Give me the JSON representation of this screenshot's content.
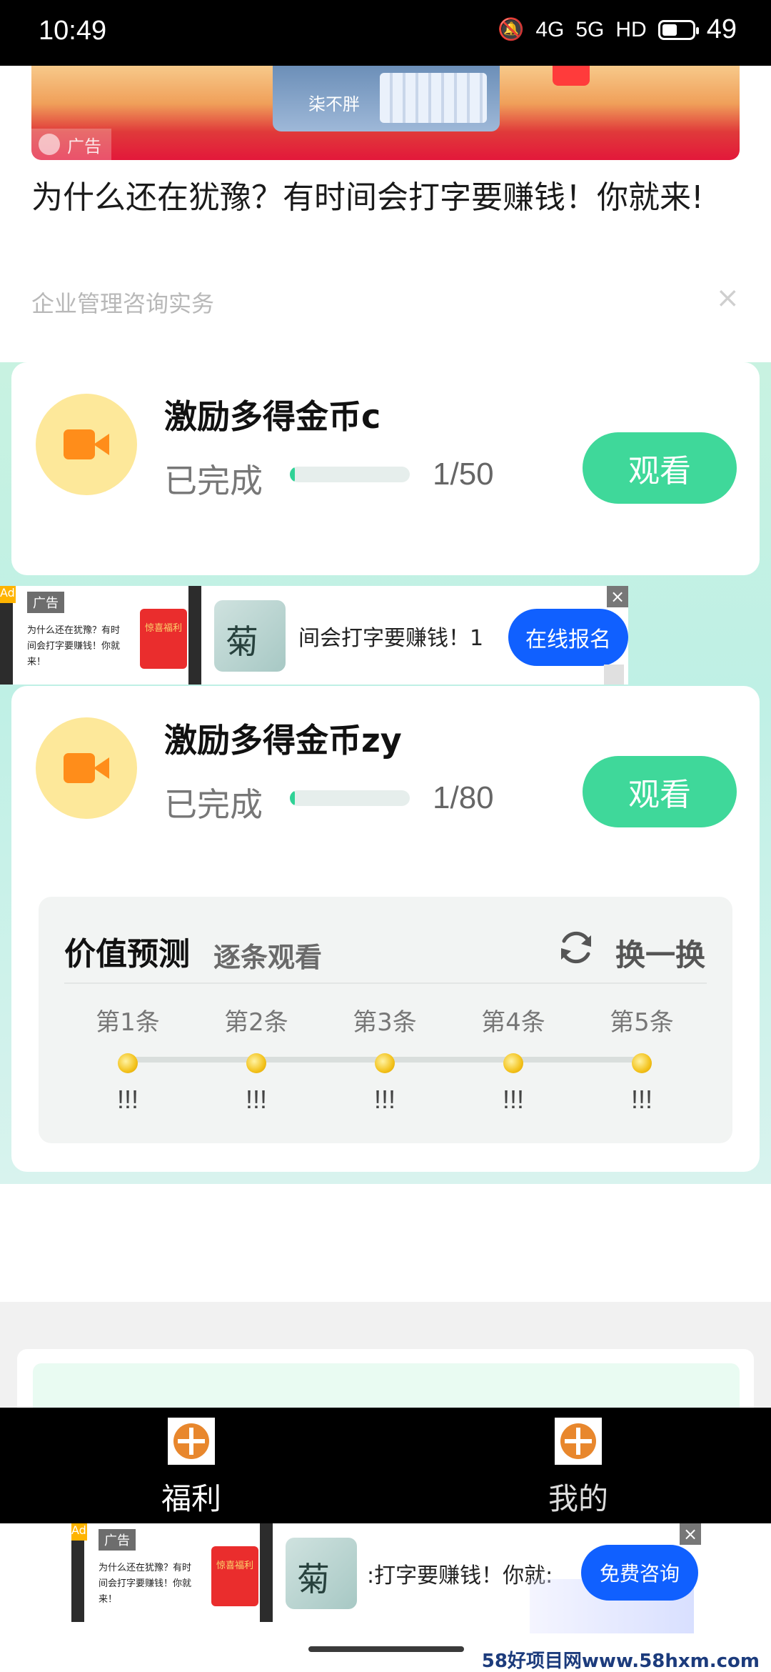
{
  "status_bar": {
    "time": "10:49",
    "mute_icon": "bell-off-icon",
    "signal1": "4G",
    "signal2": "5G",
    "hd": "HD",
    "battery": "49",
    "battery_level": 0.49
  },
  "feed_ad": {
    "banner_ad_label": "广告",
    "banner_caption": "柒不胖",
    "title": "为什么还在犹豫？有时间会打字要赚钱！你就来!",
    "source": "企业管理咨询实务",
    "close": "×"
  },
  "tasks": [
    {
      "name": "激励多得金币c",
      "status": "已完成",
      "count": "1/50",
      "progress": 0.02,
      "button": "观看",
      "icon": "video-camera-icon"
    },
    {
      "name": "激励多得金币zy",
      "status": "已完成",
      "count": "1/80",
      "progress": 0.0125,
      "button": "观看",
      "icon": "video-camera-icon"
    }
  ],
  "inline_ad": {
    "badge": "Ad",
    "tag": "广告",
    "thumb_text": "为什么还在犹豫？有时间会打字要赚钱！你就来！",
    "redpack": "惊喜福利",
    "thumb2_char": "菊",
    "text": "间会打字要赚钱！1",
    "cta": "在线报名",
    "close": "×"
  },
  "predict": {
    "title": "价值预测",
    "subtitle": "逐条观看",
    "refresh_label": "换一换",
    "slots": [
      {
        "label": "第1条",
        "value": "!!!"
      },
      {
        "label": "第2条",
        "value": "!!!"
      },
      {
        "label": "第3条",
        "value": "!!!"
      },
      {
        "label": "第4条",
        "value": "!!!"
      },
      {
        "label": "第5条",
        "value": "!!!"
      }
    ]
  },
  "tabbar": {
    "welfare": "福利",
    "mine": "我的"
  },
  "bottom_ad": {
    "badge": "Ad",
    "tag": "广告",
    "thumb_text": "为什么还在犹豫？有时间会打字要赚钱！你就来！",
    "redpack": "惊喜福利",
    "thumb2_char": "菊",
    "text": ":打字要赚钱！你就:",
    "cta": "免费咨询",
    "close": "×"
  },
  "watermark": "58好项目网www.58hxm.com"
}
